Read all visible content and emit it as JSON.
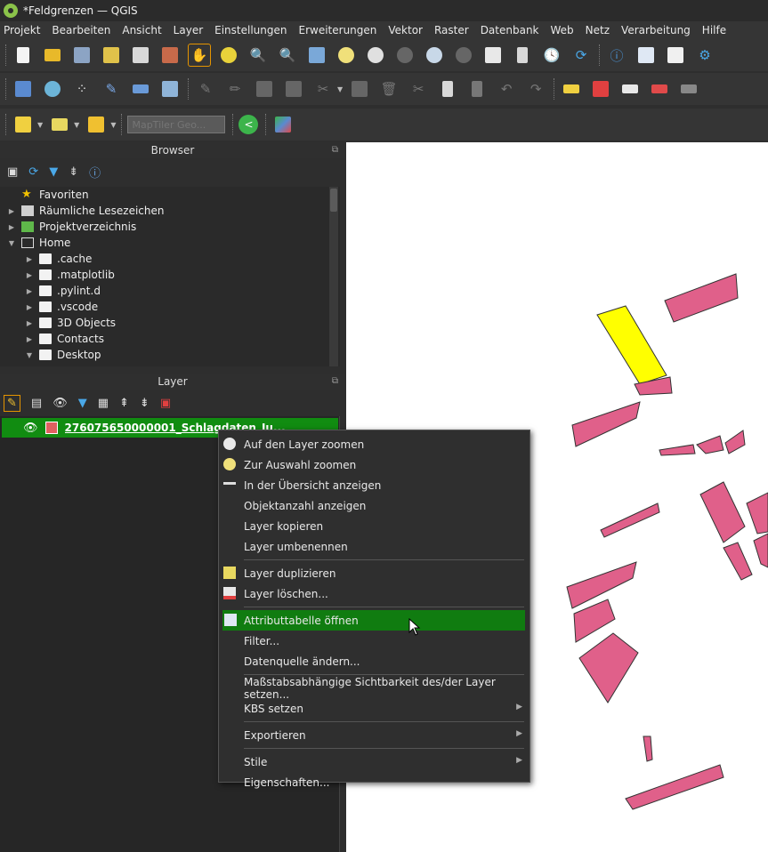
{
  "window": {
    "title": "*Feldgrenzen — QGIS"
  },
  "menubar": {
    "items": [
      "Projekt",
      "Bearbeiten",
      "Ansicht",
      "Layer",
      "Einstellungen",
      "Erweiterungen",
      "Vektor",
      "Raster",
      "Datenbank",
      "Web",
      "Netz",
      "Verarbeitung",
      "Hilfe"
    ]
  },
  "toolbar": {
    "search_placeholder": "MapTiler Geo..."
  },
  "browser": {
    "title": "Browser",
    "items": [
      {
        "label": "Favoriten",
        "icon": "star-icon"
      },
      {
        "label": "Räumliche Lesezeichen",
        "icon": "bookmark-icon"
      },
      {
        "label": "Projektverzeichnis",
        "icon": "project-folder-icon"
      },
      {
        "label": "Home",
        "icon": "home-icon"
      },
      {
        "label": ".cache",
        "icon": "folder-icon"
      },
      {
        "label": ".matplotlib",
        "icon": "folder-icon"
      },
      {
        "label": ".pylint.d",
        "icon": "folder-icon"
      },
      {
        "label": ".vscode",
        "icon": "folder-icon"
      },
      {
        "label": "3D Objects",
        "icon": "folder-icon"
      },
      {
        "label": "Contacts",
        "icon": "folder-icon"
      },
      {
        "label": "Desktop",
        "icon": "folder-icon"
      }
    ]
  },
  "layers": {
    "title": "Layer",
    "selected_layer": "276075650000001_Schlagdaten_Ju...",
    "symbol_color": "#e06060"
  },
  "context_menu": {
    "items": [
      {
        "label": "Auf den Layer zoomen",
        "icon": "zoom-layer-icon"
      },
      {
        "label": "Zur Auswahl zoomen",
        "icon": "zoom-selection-icon"
      },
      {
        "label": "In der Übersicht anzeigen",
        "icon": "overview-icon"
      },
      {
        "label": "Objektanzahl anzeigen"
      },
      {
        "label": "Layer kopieren"
      },
      {
        "label": "Layer umbenennen"
      },
      {
        "label": "Layer duplizieren",
        "icon": "duplicate-layer-icon"
      },
      {
        "label": "Layer löschen...",
        "icon": "remove-layer-icon"
      },
      {
        "label": "Attributtabelle öffnen",
        "icon": "attribute-table-icon",
        "highlighted": true
      },
      {
        "label": "Filter..."
      },
      {
        "label": "Datenquelle ändern..."
      },
      {
        "label": "Maßstabsabhängige Sichtbarkeit des/der Layer setzen..."
      },
      {
        "label": "KBS setzen",
        "submenu": true
      },
      {
        "label": "Exportieren",
        "submenu": true
      },
      {
        "label": "Stile",
        "submenu": true
      },
      {
        "label": "Eigenschaften..."
      }
    ]
  },
  "map": {
    "background": "#ffffff",
    "feature_color": "#e0608a",
    "selected_color": "#ffff00"
  }
}
